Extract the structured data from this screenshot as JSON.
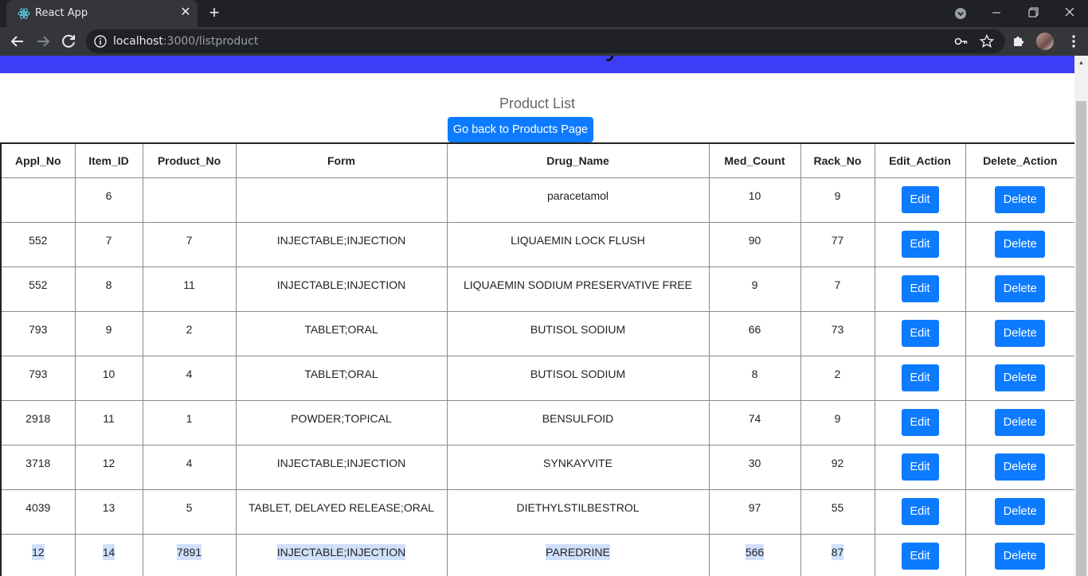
{
  "browser": {
    "tab_title": "React App",
    "url_host": "localhost",
    "url_path": ":3000/listproduct"
  },
  "page": {
    "banner_title": "PharmaBase - Powered by ASCENDERS",
    "list_title": "Product List",
    "back_button": "Go back to Products Page"
  },
  "table": {
    "headers": [
      "Appl_No",
      "Item_ID",
      "Product_No",
      "Form",
      "Drug_Name",
      "Med_Count",
      "Rack_No",
      "Edit_Action",
      "Delete_Action"
    ],
    "edit_label": "Edit",
    "delete_label": "Delete",
    "rows": [
      {
        "appl_no": "",
        "item_id": "6",
        "product_no": "",
        "form": "",
        "drug_name": "paracetamol",
        "med_count": "10",
        "rack_no": "9"
      },
      {
        "appl_no": "552",
        "item_id": "7",
        "product_no": "7",
        "form": "INJECTABLE;INJECTION",
        "drug_name": "LIQUAEMIN LOCK FLUSH",
        "med_count": "90",
        "rack_no": "77"
      },
      {
        "appl_no": "552",
        "item_id": "8",
        "product_no": "11",
        "form": "INJECTABLE;INJECTION",
        "drug_name": "LIQUAEMIN SODIUM PRESERVATIVE FREE",
        "med_count": "9",
        "rack_no": "7"
      },
      {
        "appl_no": "793",
        "item_id": "9",
        "product_no": "2",
        "form": "TABLET;ORAL",
        "drug_name": "BUTISOL SODIUM",
        "med_count": "66",
        "rack_no": "73"
      },
      {
        "appl_no": "793",
        "item_id": "10",
        "product_no": "4",
        "form": "TABLET;ORAL",
        "drug_name": "BUTISOL SODIUM",
        "med_count": "8",
        "rack_no": "2"
      },
      {
        "appl_no": "2918",
        "item_id": "11",
        "product_no": "1",
        "form": "POWDER;TOPICAL",
        "drug_name": "BENSULFOID",
        "med_count": "74",
        "rack_no": "9"
      },
      {
        "appl_no": "3718",
        "item_id": "12",
        "product_no": "4",
        "form": "INJECTABLE;INJECTION",
        "drug_name": "SYNKAYVITE",
        "med_count": "30",
        "rack_no": "92"
      },
      {
        "appl_no": "4039",
        "item_id": "13",
        "product_no": "5",
        "form": "TABLET, DELAYED RELEASE;ORAL",
        "drug_name": "DIETHYLSTILBESTROL",
        "med_count": "97",
        "rack_no": "55"
      },
      {
        "appl_no": "12",
        "item_id": "14",
        "product_no": "7891",
        "form": "INJECTABLE;INJECTION",
        "drug_name": "PAREDRINE",
        "med_count": "566",
        "rack_no": "87"
      }
    ]
  },
  "colors": {
    "banner": "#3d3df8",
    "button": "#0d7bff",
    "selection": "#cfe0fb"
  }
}
